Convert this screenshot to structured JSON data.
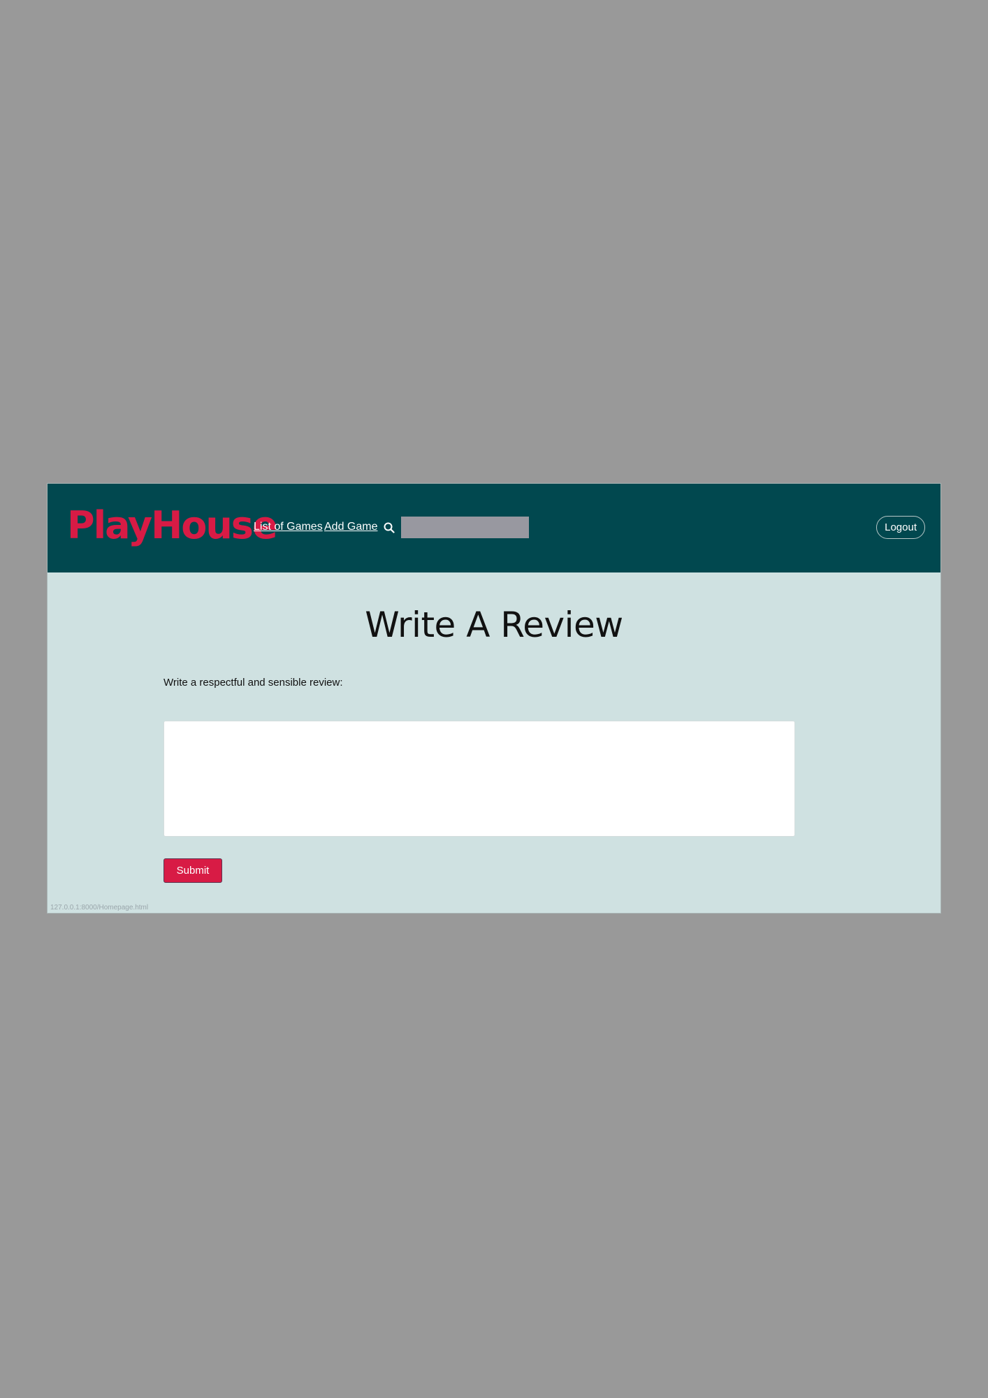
{
  "header": {
    "brand": "PlayHouse",
    "nav": {
      "list_of_games": "List of Games",
      "add_game": "Add Game"
    },
    "search": {
      "value": "",
      "icon": "search-icon"
    },
    "logout_label": "Logout"
  },
  "main": {
    "title": "Write A Review",
    "prompt": "Write a respectful and sensible review:",
    "review_value": "",
    "submit_label": "Submit"
  },
  "status_bar": {
    "url": "127.0.0.1:8000/Homepage.html"
  },
  "colors": {
    "page_background": "#999999",
    "navbar": "#01484f",
    "content_background": "#cfe1e1",
    "brand": "#d81b45",
    "search_field": "#9898a0",
    "submit_button": "#d81b45"
  }
}
